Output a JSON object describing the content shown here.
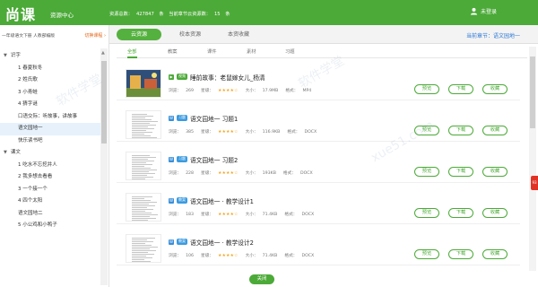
{
  "header": {
    "logo": "尚课",
    "subtitle": "资源中心",
    "stats": {
      "total_label": "资源总数：",
      "total_value": "427847",
      "unit1": "条",
      "chapter_label": "当前章节云资源数：",
      "chapter_value": "15",
      "unit2": "条"
    },
    "login_label": "未登录"
  },
  "sidebar": {
    "grade": "一年级语文下册 人教部编版",
    "switch_label": "切换课程 ›",
    "tree": [
      {
        "label": "识字",
        "type": "unit"
      },
      {
        "label": "1 春夏秋冬",
        "type": "lesson"
      },
      {
        "label": "2 姓氏歌",
        "type": "lesson"
      },
      {
        "label": "3 小青蛙",
        "type": "lesson"
      },
      {
        "label": "4 猜字谜",
        "type": "lesson"
      },
      {
        "label": "口语交际：听故事，讲故事",
        "type": "lesson"
      },
      {
        "label": "语文园地一",
        "type": "lesson",
        "active": true
      },
      {
        "label": "快乐读书吧",
        "type": "lesson"
      },
      {
        "label": "课文",
        "type": "unit"
      },
      {
        "label": "1 吃水不忘挖井人",
        "type": "lesson"
      },
      {
        "label": "2 我多想去看看",
        "type": "lesson"
      },
      {
        "label": "3 一个接一个",
        "type": "lesson"
      },
      {
        "label": "4 四个太阳",
        "type": "lesson"
      },
      {
        "label": "语文园地二",
        "type": "lesson"
      },
      {
        "label": "5 小公鸡和小鸭子",
        "type": "lesson"
      }
    ]
  },
  "main_tabs": [
    {
      "label": "云资源",
      "active": true
    },
    {
      "label": "校本资源",
      "active": false
    },
    {
      "label": "本资收藏",
      "active": false
    }
  ],
  "current_chapter": "当前章节：语文园地一",
  "sub_tabs": [
    {
      "label": "全部",
      "active": true
    },
    {
      "label": "教案"
    },
    {
      "label": "课件"
    },
    {
      "label": "素材"
    },
    {
      "label": "习题"
    }
  ],
  "labels": {
    "views": "浏览：",
    "rating": "星级：",
    "size": "大小：",
    "format": "格式：",
    "preview": "预览",
    "download": "下载",
    "favorite": "收藏",
    "close": "关闭"
  },
  "resources": [
    {
      "title": "睡前故事：老鼠嫁女儿_杨清",
      "badge": "视频",
      "format_icon": "mp4",
      "views": "269",
      "stars": "★★★★☆",
      "size": "17.9MB",
      "format": "MP4"
    },
    {
      "title": "语文园地一 习题1",
      "badge": "习题",
      "format_icon": "doc",
      "views": "385",
      "stars": "★★★★☆",
      "size": "116.9KB",
      "format": "DOCX"
    },
    {
      "title": "语文园地一 习题2",
      "badge": "习题",
      "format_icon": "doc",
      "views": "228",
      "stars": "★★★★☆",
      "size": "193KB",
      "format": "DOCX"
    },
    {
      "title": "语文园地一 · 教学设计1",
      "badge": "教案",
      "format_icon": "doc",
      "views": "183",
      "stars": "★★★★☆",
      "size": "71.4KB",
      "format": "DOCX"
    },
    {
      "title": "语文园地一 · 教学设计2",
      "badge": "教案",
      "format_icon": "doc",
      "views": "106",
      "stars": "★★★★☆",
      "size": "71.4KB",
      "format": "DOCX"
    }
  ],
  "side_badge": "93",
  "colors": {
    "brand": "#4caa38",
    "link": "#2f7ad8",
    "star": "#f5a623"
  }
}
